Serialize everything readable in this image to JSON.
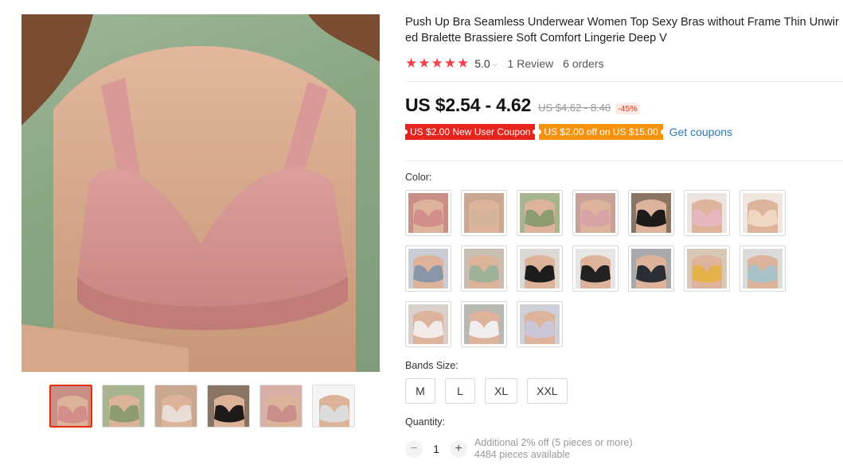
{
  "product": {
    "title": "Push Up Bra Seamless Underwear Women Top Sexy Bras without Frame Thin Unwired Bralette Brassiere Soft Comfort Lingerie Deep V",
    "rating": "5.0",
    "stars": 5,
    "reviews": "1 Review",
    "orders": "6 orders"
  },
  "price": {
    "current": "US $2.54 - 4.62",
    "original": "US $4.62 - 8.40",
    "discount": "-45%"
  },
  "coupons": {
    "new_user": "US $2.00 New User Coupon",
    "store": "US $2.00 off on US $15.00",
    "get_link": "Get coupons"
  },
  "color_section": {
    "label": "Color:",
    "swatches": [
      {
        "bg": "#c98f86",
        "cloth": "#d38e8c"
      },
      {
        "bg": "#c8a890",
        "cloth": "#d4b49a"
      },
      {
        "bg": "#a8b48e",
        "cloth": "#8d9c70"
      },
      {
        "bg": "#c7a19a",
        "cloth": "#d7a3a6"
      },
      {
        "bg": "#8a7464",
        "cloth": "#1e1a1a"
      },
      {
        "bg": "#ece4e0",
        "cloth": "#e6b7be"
      },
      {
        "bg": "#efe6df",
        "cloth": "#f0d7c1"
      },
      {
        "bg": "#c9cdd4",
        "cloth": "#8996a8"
      },
      {
        "bg": "#c8bfb2",
        "cloth": "#9eb29a"
      },
      {
        "bg": "#ddd8d4",
        "cloth": "#1d1d1d"
      },
      {
        "bg": "#e8e6e4",
        "cloth": "#222222"
      },
      {
        "bg": "#a7a9ad",
        "cloth": "#2a2d34"
      },
      {
        "bg": "#d8c8b5",
        "cloth": "#e5b24a"
      },
      {
        "bg": "#d9dcd8",
        "cloth": "#a9c2c9"
      },
      {
        "bg": "#d9cfcb",
        "cloth": "#f2ebe8"
      },
      {
        "bg": "#b7b9b2",
        "cloth": "#f0eeee"
      },
      {
        "bg": "#cdd0d8",
        "cloth": "#cbc6d8"
      }
    ]
  },
  "bands_section": {
    "label": "Bands Size:",
    "sizes": [
      "M",
      "L",
      "XL",
      "XXL"
    ]
  },
  "quantity_section": {
    "label": "Quantity:",
    "value": "1",
    "minus": "−",
    "plus": "+",
    "note_discount": "Additional 2% off (5 pieces or more)",
    "note_available": "4484 pieces available"
  },
  "gallery": {
    "thumbs": [
      {
        "bg": "#c98f86",
        "cloth": "#d38e8c"
      },
      {
        "bg": "#a8b48e",
        "cloth": "#8d9c70"
      },
      {
        "bg": "#c8a890",
        "cloth": "#e8ddd6"
      },
      {
        "bg": "#8a7464",
        "cloth": "#1e1a1a"
      },
      {
        "bg": "#d8b0a8",
        "cloth": "#c98d8a"
      },
      {
        "bg": "#f4f4f4",
        "cloth": "#dcdcdc"
      }
    ]
  },
  "colors": {
    "accent_red": "#e62e04",
    "star_red": "#f5404a",
    "coupon_red": "#e6241b",
    "coupon_orange": "#f7920f",
    "link_blue": "#2a7ab8"
  }
}
